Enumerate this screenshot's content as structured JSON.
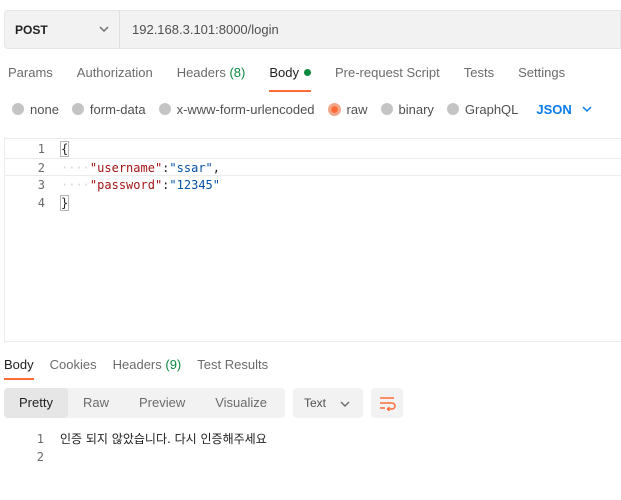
{
  "request": {
    "method": "POST",
    "url": "192.168.3.101:8000/login"
  },
  "request_tabs": [
    {
      "label": "Params"
    },
    {
      "label": "Authorization"
    },
    {
      "label": "Headers",
      "count": "(8)"
    },
    {
      "label": "Body"
    },
    {
      "label": "Pre-request Script"
    },
    {
      "label": "Tests"
    },
    {
      "label": "Settings"
    }
  ],
  "body_types": [
    "none",
    "form-data",
    "x-www-form-urlencoded",
    "raw",
    "binary",
    "GraphQL"
  ],
  "body_type_selected": "raw",
  "body_language": "JSON",
  "editor": {
    "line_numbers": [
      "1",
      "2",
      "3",
      "4"
    ],
    "open_brace": "{",
    "close_brace": "}",
    "ws": "····",
    "q": "\"",
    "colon": ":",
    "comma": ",",
    "username_key": "username",
    "username_value": "ssar",
    "password_key": "password",
    "password_value": "12345"
  },
  "response_tabs": [
    {
      "label": "Body"
    },
    {
      "label": "Cookies"
    },
    {
      "label": "Headers",
      "count": "(9)"
    },
    {
      "label": "Test Results"
    }
  ],
  "view_modes": [
    "Pretty",
    "Raw",
    "Preview",
    "Visualize"
  ],
  "format": "Text",
  "response": {
    "line_numbers": [
      "1",
      "2"
    ],
    "lines": [
      "인증 되지 않았습니다. 다시 인증해주세요",
      ""
    ]
  },
  "colors": {
    "accent": "#ff6c37",
    "count_green": "#0a8a3f",
    "link_blue": "#097bed"
  }
}
